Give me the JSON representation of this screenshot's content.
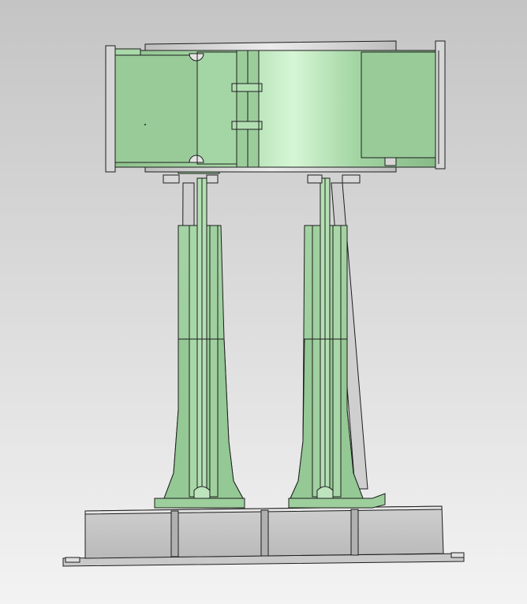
{
  "viewport": {
    "background_top": "#c4c4c4",
    "background_bottom": "#f3f3f3"
  },
  "model": {
    "part_fill": "#9fcf9f",
    "part_highlight": "#d6f6d6",
    "part_shadow": "#7fb07f",
    "metal_fill": "#d4d4d4",
    "metal_light": "#ececec",
    "metal_shadow": "#a8a8a8",
    "edge_color": "#1e1e1e"
  }
}
